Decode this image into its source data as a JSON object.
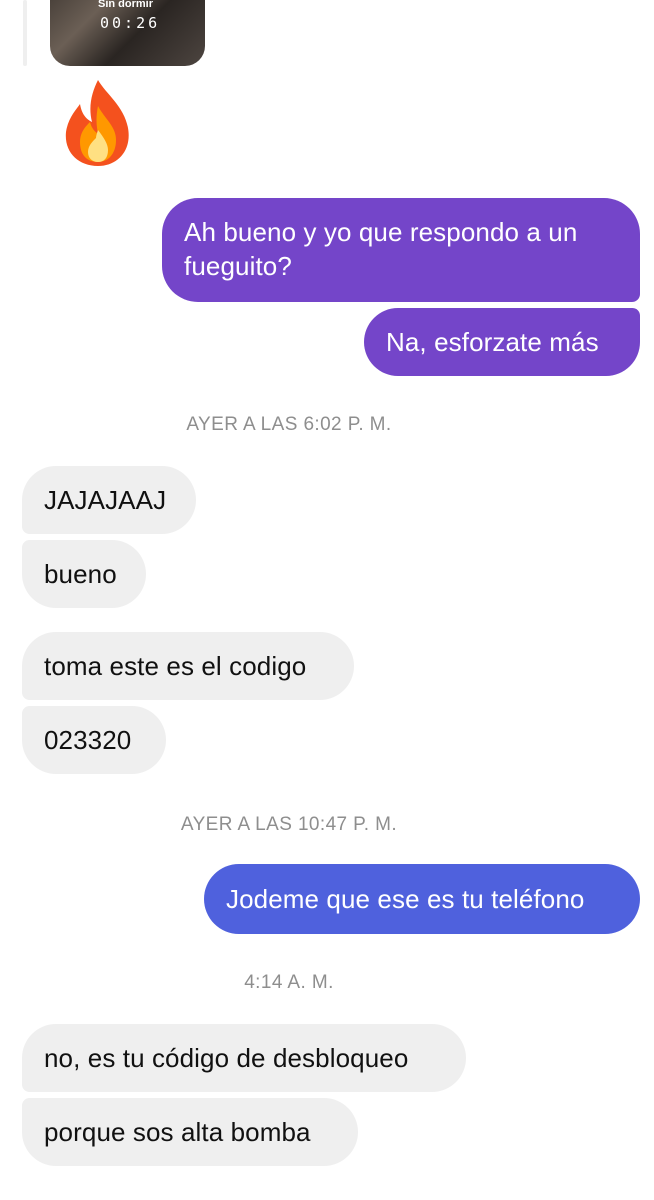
{
  "story_reply": {
    "preview_caption": "Sin dormir",
    "preview_timer": "00:26"
  },
  "reaction_emoji": "🔥",
  "messages": [
    {
      "text": "Ah bueno y yo que respondo a un fueguito?"
    },
    {
      "text": "Na, esforzate más"
    },
    {
      "text": "JAJAJAAJ"
    },
    {
      "text": "bueno"
    },
    {
      "text": "toma este es el codigo"
    },
    {
      "text": "023320"
    },
    {
      "text": "Jodeme que ese es tu teléfono"
    },
    {
      "text": "no, es tu código de desbloqueo"
    },
    {
      "text": "porque sos alta bomba"
    }
  ],
  "timestamps": [
    "AYER A LAS 6:02 P. M.",
    "AYER A LAS 10:47 P. M.",
    "4:14 A. M."
  ],
  "colors": {
    "sent_purple": "#7445c9",
    "sent_blue": "#4f61dd",
    "received_bg": "#efefef",
    "timestamp_gray": "#8e8e8e"
  }
}
